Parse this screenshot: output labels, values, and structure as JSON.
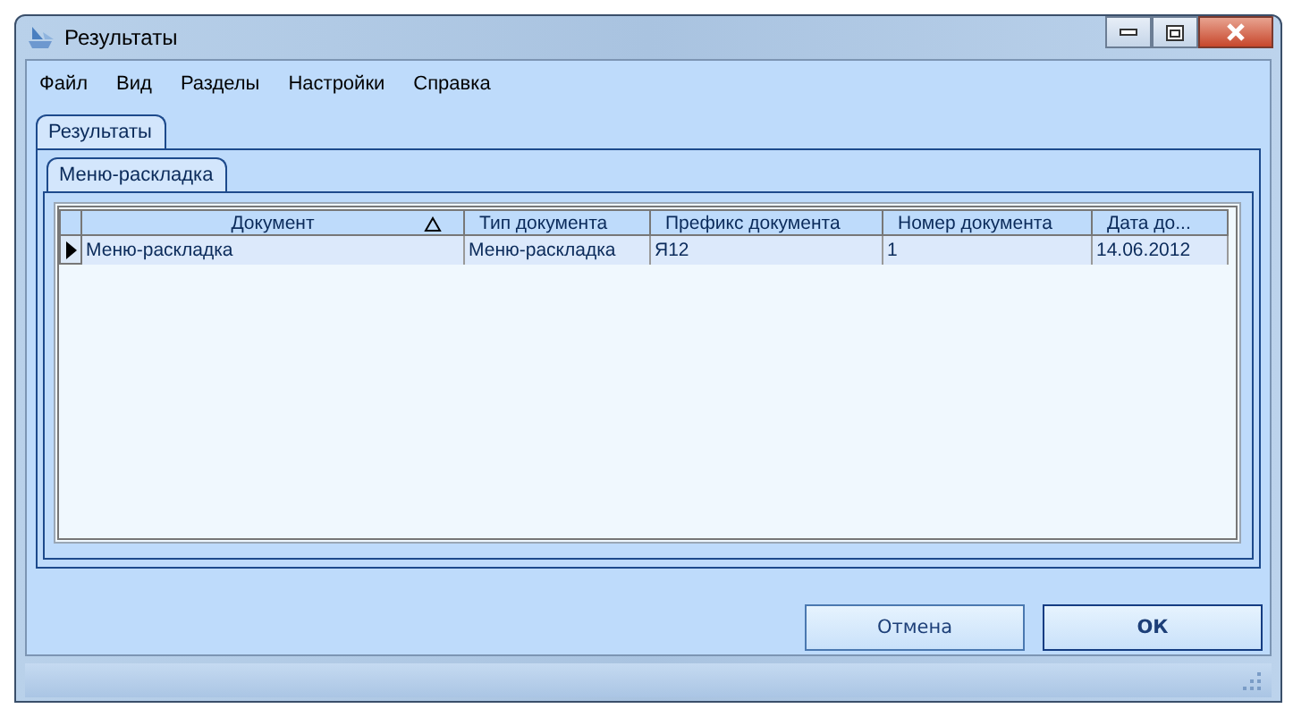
{
  "window": {
    "title": "Результаты"
  },
  "menu": [
    "Файл",
    "Вид",
    "Разделы",
    "Настройки",
    "Справка"
  ],
  "outer_tabs": [
    {
      "label": "Результаты",
      "selected": true
    }
  ],
  "inner_tabs": [
    {
      "label": "Меню-раскладка",
      "selected": true
    }
  ],
  "table": {
    "columns": [
      {
        "label": "Документ",
        "sorted": true
      },
      {
        "label": "Тип документа",
        "sorted": false
      },
      {
        "label": "Префикс документа",
        "sorted": false
      },
      {
        "label": "Номер документа",
        "sorted": false
      },
      {
        "label": "Дата до...",
        "sorted": false
      }
    ],
    "rows": [
      {
        "selected": true,
        "cells": [
          "Меню-раскладка",
          "Меню-раскладка",
          "Я12",
          "1",
          "14.06.2012"
        ]
      }
    ]
  },
  "buttons": [
    {
      "label": "Отмена",
      "default": false
    },
    {
      "label": "ОК",
      "default": true
    }
  ]
}
